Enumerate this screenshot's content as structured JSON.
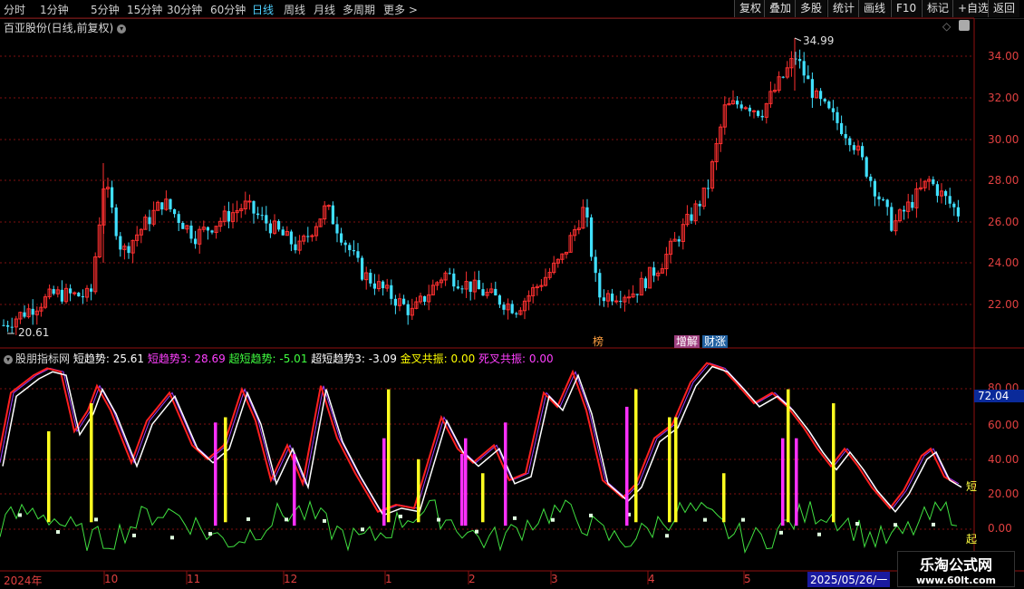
{
  "toolbar": {
    "periods": [
      "分时",
      "1分钟",
      "5分钟",
      "15分钟",
      "30分钟",
      "60分钟",
      "日线",
      "周线",
      "月线",
      "多周期",
      "更多 >"
    ],
    "active_period": "日线",
    "right_buttons": [
      "复权",
      "叠加",
      "多股",
      "统计",
      "画线",
      "F10",
      "标记",
      "+自选",
      "返回"
    ]
  },
  "main_panel": {
    "title": "百亚股份(日线,前复权)",
    "high_label": "34.99",
    "low_label": "20.61",
    "y_ticks": [
      "34.00",
      "32.00",
      "30.00",
      "28.00",
      "26.00",
      "24.00",
      "22.00"
    ],
    "events": [
      "榜",
      "增解",
      "财涨"
    ]
  },
  "indicator_panel": {
    "name": "股朋指标网",
    "items": [
      {
        "label": "短趋势: 25.61",
        "color": "#ffffff"
      },
      {
        "label": "短趋势3: 28.69",
        "color": "#ff40ff"
      },
      {
        "label": "超短趋势: -5.01",
        "color": "#40ff40"
      },
      {
        "label": "超短趋势3: -3.09",
        "color": "#ffffff"
      },
      {
        "label": "金叉共振: 0.00",
        "color": "#ffff00"
      },
      {
        "label": "死叉共振: 0.00",
        "color": "#ff40ff"
      }
    ],
    "y_ticks": [
      "80.00",
      "60.00",
      "40.00",
      "20.00",
      "0.00"
    ],
    "current_value": "72.04",
    "side_marks": [
      "短",
      "起"
    ]
  },
  "x_axis": {
    "labels": [
      "2024年",
      "10",
      "11",
      "12",
      "1",
      "2",
      "3",
      "4",
      "5"
    ],
    "current_date": "2025/05/26/一"
  },
  "watermark": {
    "name": "乐淘公式网",
    "url": "www.60lt.com"
  },
  "colors": {
    "up": "#ff3030",
    "down": "#40e0ff",
    "grid": "#801010",
    "axis": "#e04040"
  }
}
